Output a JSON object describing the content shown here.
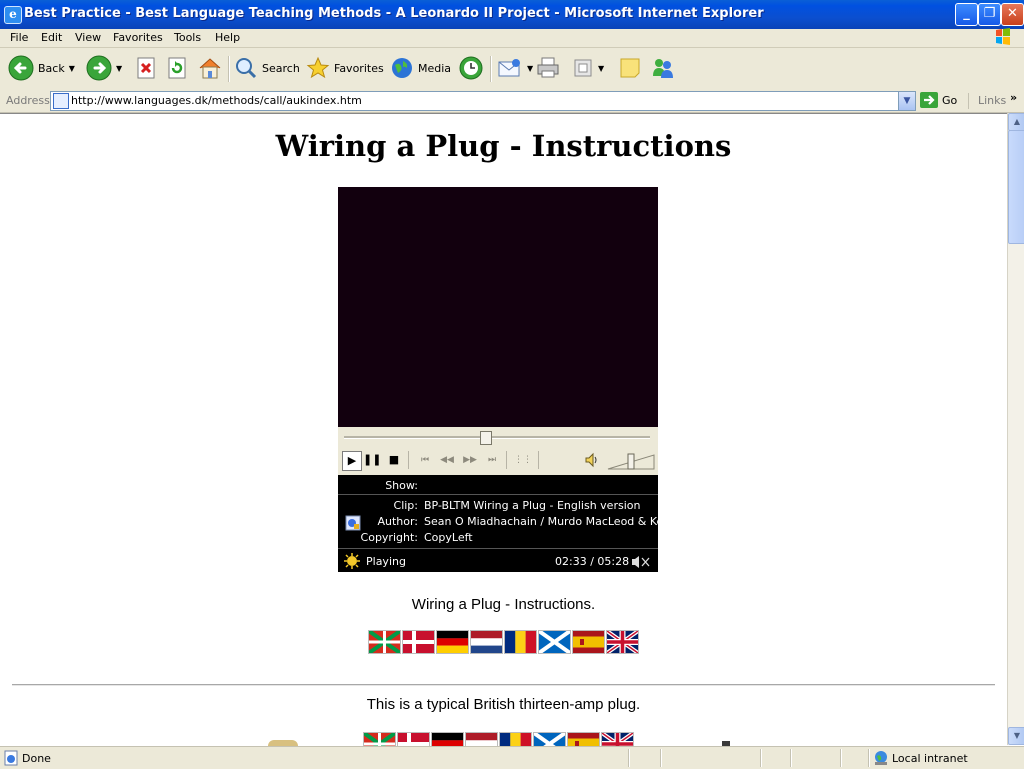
{
  "window": {
    "title": "Best Practice - Best Language Teaching Methods - A Leonardo II Project - Microsoft Internet Explorer",
    "minimize": "_",
    "maximize": "❐",
    "close": "✕"
  },
  "menu": [
    "File",
    "Edit",
    "View",
    "Favorites",
    "Tools",
    "Help"
  ],
  "toolbar": {
    "back": "Back",
    "search": "Search",
    "favorites": "Favorites",
    "media": "Media"
  },
  "address": {
    "label": "Address",
    "url": "http://www.languages.dk/methods/call/aukindex.htm",
    "go": "Go",
    "links": "Links"
  },
  "page": {
    "heading": "Wiring a Plug - Instructions",
    "player": {
      "show_label": "Show:",
      "show_value": "",
      "clip_label": "Clip:",
      "clip_value": "BP-BLTM Wiring a Plug - English version",
      "author_label": "Author:",
      "author_value": "Sean O Miadhachain / Murdo MacLeod  & Kent",
      "copyright_label": "Copyright:",
      "copyright_value": "CopyLeft",
      "status": "Playing",
      "time": "02:33 / 05:28",
      "position_fraction": 0.47
    },
    "caption1": "Wiring a Plug - Instructions.",
    "caption2": "This is a typical British thirteen-amp plug.",
    "flags": [
      "basque-flag",
      "danish-flag",
      "german-flag",
      "dutch-flag",
      "romanian-flag",
      "scottish-flag",
      "spanish-flag",
      "union-jack-flag"
    ]
  },
  "status": {
    "text": "Done",
    "zone": "Local intranet"
  }
}
